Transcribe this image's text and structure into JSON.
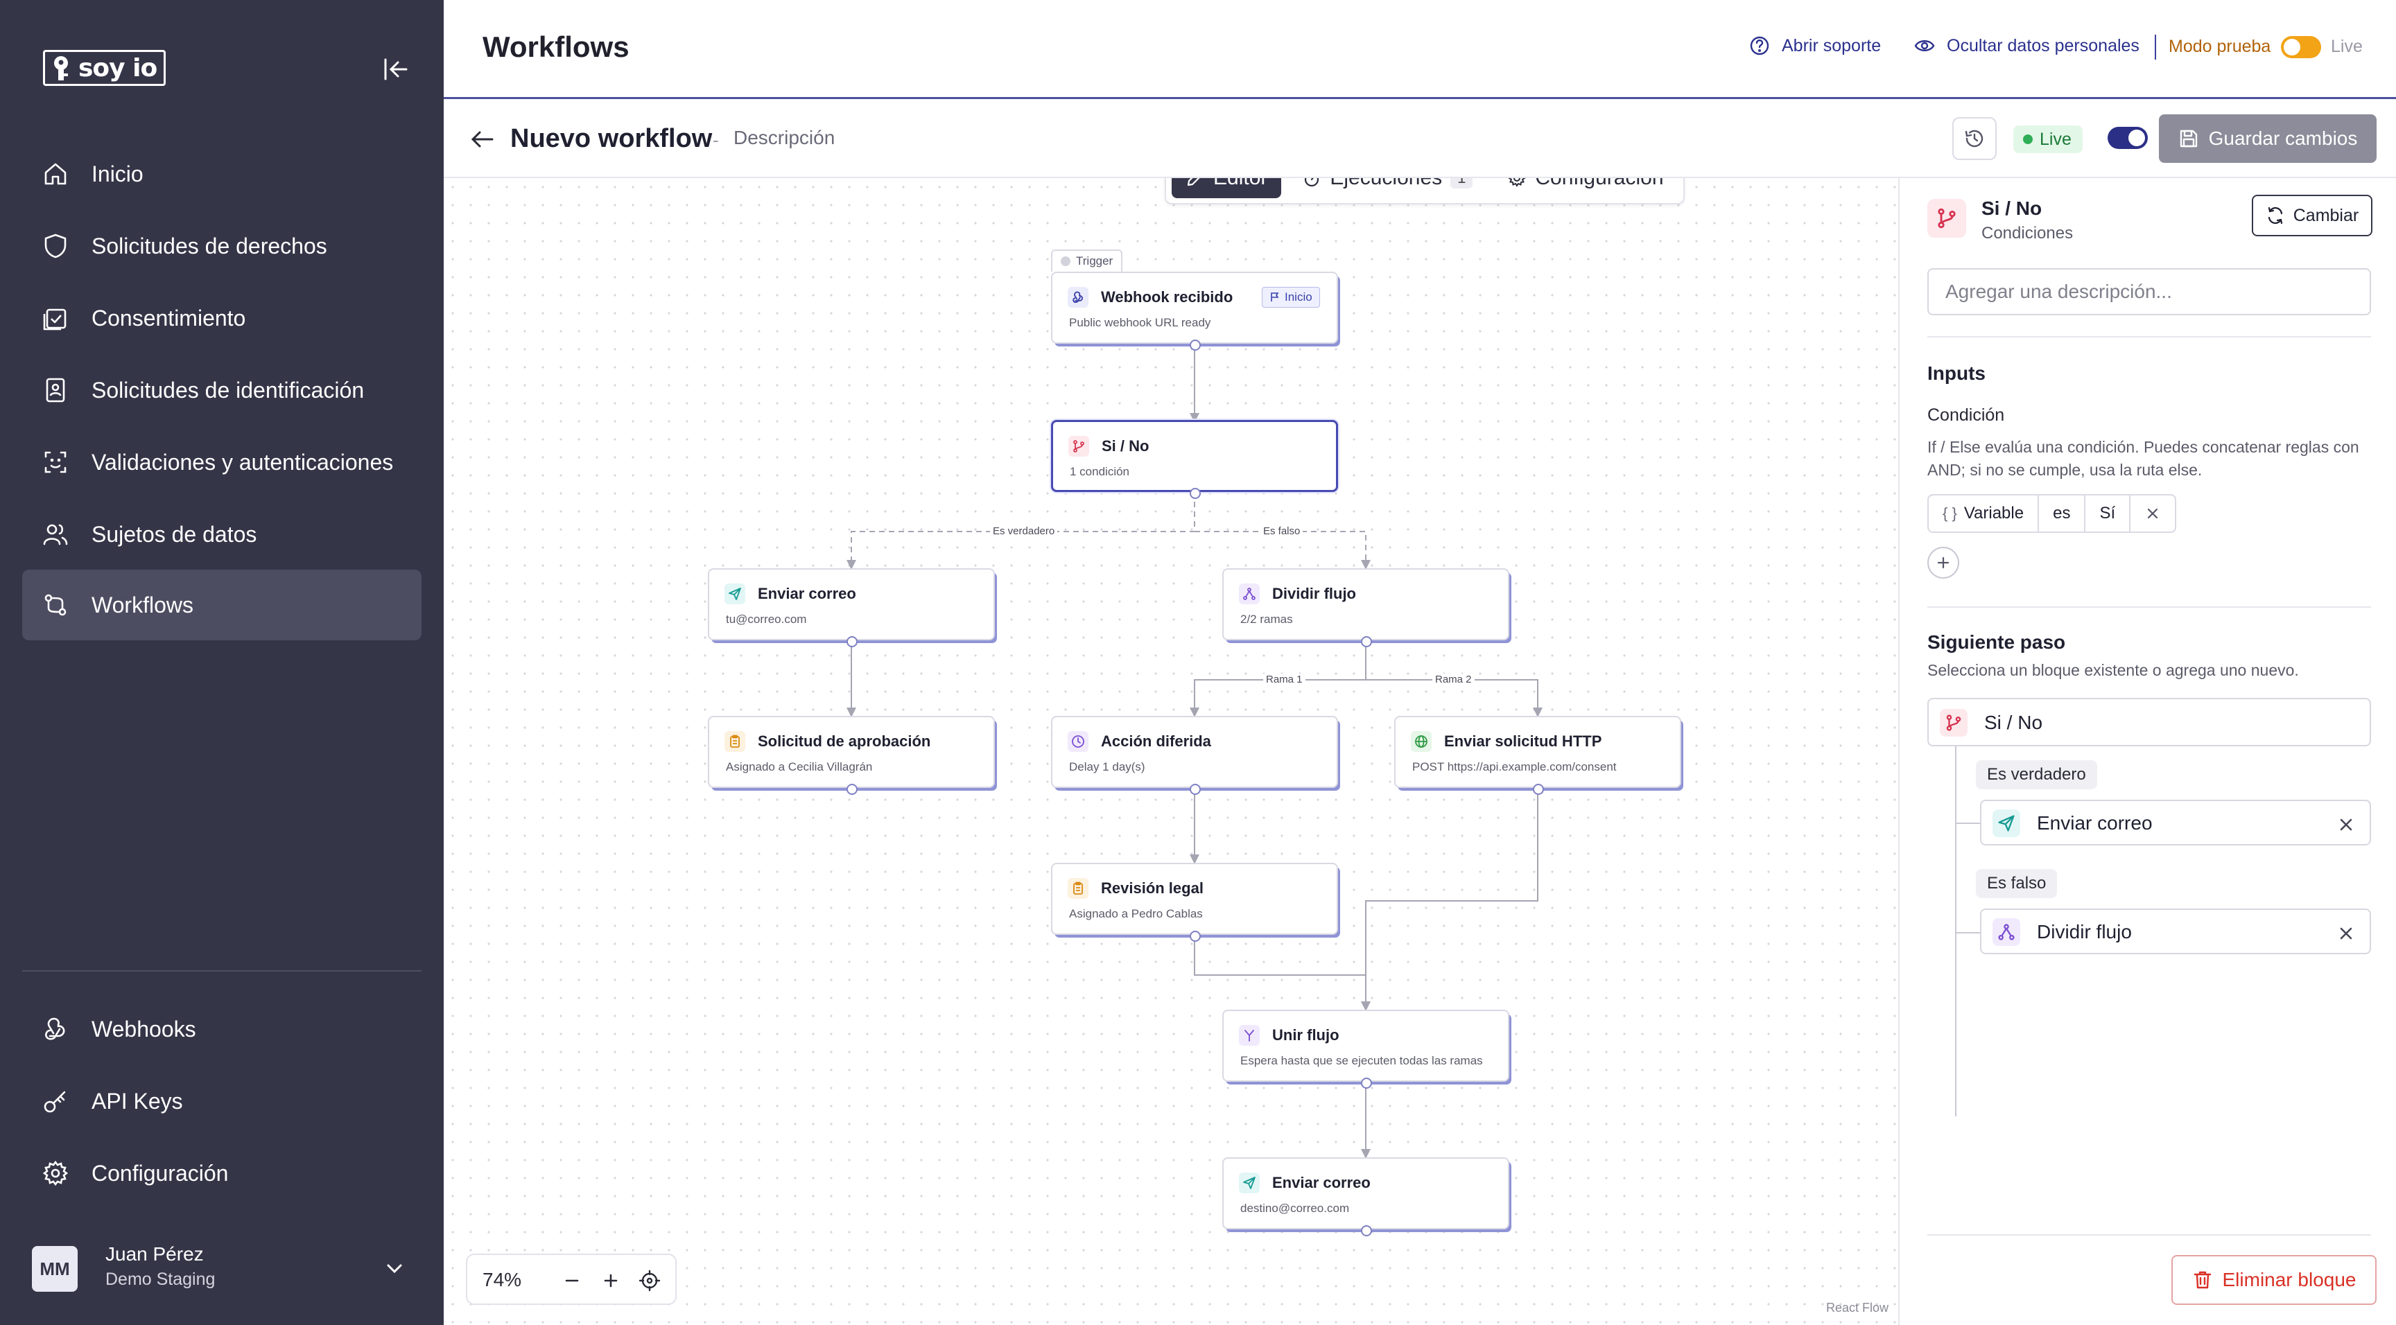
{
  "sidebar": {
    "logo_text": "soy io",
    "nav": [
      {
        "label": "Inicio",
        "icon": "home-icon"
      },
      {
        "label": "Solicitudes de derechos",
        "icon": "shield-icon"
      },
      {
        "label": "Consentimiento",
        "icon": "calendar-check-icon"
      },
      {
        "label": "Solicitudes de identificación",
        "icon": "id-badge-icon"
      },
      {
        "label": "Validaciones y autenticaciones",
        "icon": "face-scan-icon"
      },
      {
        "label": "Sujetos de datos",
        "icon": "users-icon"
      },
      {
        "label": "Workflows",
        "icon": "workflow-icon",
        "active": true
      }
    ],
    "bottom_nav": [
      {
        "label": "Webhooks",
        "icon": "webhook-icon"
      },
      {
        "label": "API Keys",
        "icon": "key-icon"
      },
      {
        "label": "Configuración",
        "icon": "gear-icon"
      }
    ],
    "user": {
      "initials": "MM",
      "name": "Juan Pérez",
      "org": "Demo Staging"
    }
  },
  "topbar": {
    "title": "Workflows",
    "support_link": "Abrir soporte",
    "privacy_link": "Ocultar datos personales",
    "mode_label": "Modo prueba",
    "live_label": "Live"
  },
  "workflow": {
    "name": "Nuevo workflow",
    "separator": "-",
    "description": "Descripción",
    "status": "Live",
    "save_label": "Guardar cambios"
  },
  "tabs": [
    {
      "label": "Editor",
      "active": true
    },
    {
      "label": "Ejecuciones",
      "count": "1"
    },
    {
      "label": "Configuración"
    }
  ],
  "canvas": {
    "trigger_tag": "Trigger",
    "start_badge": "Inicio",
    "nodes": [
      {
        "id": "webhook",
        "title": "Webhook recibido",
        "subtitle": "Public webhook URL ready",
        "icon": "webhook-icon"
      },
      {
        "id": "sino",
        "title": "Si / No",
        "subtitle": "1 condición",
        "icon": "branch-icon"
      },
      {
        "id": "correo1",
        "title": "Enviar correo",
        "subtitle": "tu@correo.com",
        "icon": "send-icon"
      },
      {
        "id": "dividir",
        "title": "Dividir flujo",
        "subtitle": "2/2 ramas",
        "icon": "split-icon"
      },
      {
        "id": "aprobacion",
        "title": "Solicitud de aprobación",
        "subtitle": "Asignado a Cecilia Villagrán",
        "icon": "clipboard-icon"
      },
      {
        "id": "diferida",
        "title": "Acción diferida",
        "subtitle": "Delay 1 day(s)",
        "icon": "clock-icon"
      },
      {
        "id": "http",
        "title": "Enviar solicitud HTTP",
        "subtitle": "POST https://api.example.com/consent",
        "icon": "globe-icon"
      },
      {
        "id": "legal",
        "title": "Revisión legal",
        "subtitle": "Asignado a Pedro Cablas",
        "icon": "clipboard-icon"
      },
      {
        "id": "unir",
        "title": "Unir flujo",
        "subtitle": "Espera hasta que se ejecuten todas las ramas",
        "icon": "merge-icon"
      },
      {
        "id": "correo2",
        "title": "Enviar correo",
        "subtitle": "destino@correo.com",
        "icon": "send-icon"
      }
    ],
    "edge_labels": {
      "true": "Es verdadero",
      "false": "Es falso",
      "rama1": "Rama 1",
      "rama2": "Rama 2"
    },
    "zoom": "74%",
    "attribution": "React Flow"
  },
  "panel": {
    "title": "Si / No",
    "subtitle": "Condiciones",
    "change_label": "Cambiar",
    "description_placeholder": "Agregar una descripción...",
    "inputs_heading": "Inputs",
    "condition_label": "Condición",
    "condition_help": "If / Else evalúa una condición. Puedes concatenar reglas con AND; si no se cumple, usa la ruta else.",
    "condition": {
      "variable_icon": "{ }",
      "variable": "Variable",
      "operator": "es",
      "value": "Sí"
    },
    "next_heading": "Siguiente paso",
    "next_help": "Selecciona un bloque existente o agrega uno nuevo.",
    "current_step": "Si / No",
    "true_label": "Es verdadero",
    "true_step": "Enviar correo",
    "false_label": "Es falso",
    "false_step": "Dividir flujo",
    "delete_label": "Eliminar bloque"
  },
  "colors": {
    "sidebar": "#353548",
    "accent": "#2b2f86",
    "live_green": "#2fae57",
    "danger": "#d93025",
    "test_mode": "#f2a316"
  }
}
